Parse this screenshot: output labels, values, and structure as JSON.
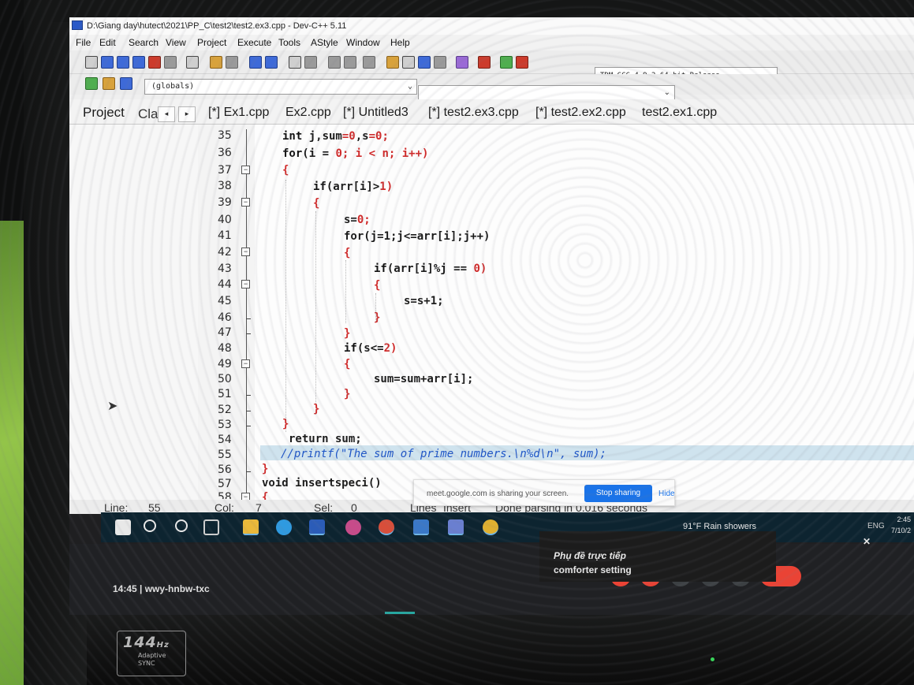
{
  "window": {
    "title": "D:\\Giang day\\hutect\\2021\\PP_C\\test2\\test2.ex3.cpp - Dev-C++ 5.11"
  },
  "menu": [
    "File",
    "Edit",
    "Search",
    "View",
    "Project",
    "Execute",
    "Tools",
    "AStyle",
    "Window",
    "Help"
  ],
  "toolbar": {
    "compiler": "TDM-GCC 4.9.2 64-bit Release",
    "scope": "(globals)"
  },
  "panel": {
    "project_tab": "Project",
    "classes_tab": "Cla",
    "prev": "◂",
    "next": "▸"
  },
  "tabs": [
    "[*] Ex1.cpp",
    "Ex2.cpp",
    "[*] Untitled3",
    "[*] test2.ex3.cpp",
    "[*] test2.ex2.cpp",
    "test2.ex1.cpp"
  ],
  "editor": {
    "line_numbers": [
      "35",
      "36",
      "37",
      "38",
      "39",
      "40",
      "41",
      "42",
      "43",
      "44",
      "45",
      "46",
      "47",
      "48",
      "49",
      "50",
      "51",
      "52",
      "53",
      "54",
      "55",
      "56",
      "57",
      "58"
    ],
    "lines": {
      "l35a": "int ",
      "l35b": "j,sum",
      "l35c": "=0",
      "l35d": ",s",
      "l35e": "=0",
      "l35f": ";",
      "l36a": "for",
      "l36b": "(i = ",
      "l36c": "0",
      "l36d": "; i < n; i++)",
      "l37": "{",
      "l38a": "if",
      "l38b": "(arr[i]>",
      "l38c": "1",
      "l38d": ")",
      "l39": "{",
      "l40a": "s=",
      "l40b": "0",
      "l40c": ";",
      "l41": "for(j=1;j<=arr[i];j++)",
      "l42": "{",
      "l43a": "if",
      "l43b": "(arr[i]%j == ",
      "l43c": "0",
      "l43d": ")",
      "l44": "{",
      "l45": "s=s+1;",
      "l46": "}",
      "l47": "}",
      "l48a": "if",
      "l48b": "(s<=",
      "l48c": "2",
      "l48d": ")",
      "l49": "{",
      "l50": "sum=sum+arr[i];",
      "l51": "}",
      "l52": "}",
      "l53": "}",
      "l54": "return sum;",
      "l55": "//printf(\"The sum of prime numbers.\\n%d\\n\", sum);",
      "l56": "}",
      "l57": "void insertspeci()",
      "l58": "{"
    }
  },
  "status": {
    "line_label": "Line:",
    "line_value": "55",
    "col_label": "Col:",
    "col_value": "7",
    "sel_label": "Sel:",
    "sel_value": "0",
    "lines_label": "Lines",
    "insert": "Insert",
    "parse": "Done parsing in 0.016 seconds"
  },
  "share_bar": {
    "message": "meet.google.com is sharing your screen.",
    "stop": "Stop sharing",
    "hide": "Hide"
  },
  "taskbar": {
    "weather": "91°F Rain showers",
    "lang": "ENG",
    "time": "2:45",
    "date": "7/10/2"
  },
  "captions": {
    "close": "✕",
    "line1": "Phụ đề trực tiếp",
    "line2": "comforter setting"
  },
  "meet": {
    "time_code": "14:45 | wwy-hnbw-txc"
  },
  "monitor": {
    "refresh": "144",
    "hz_unit": "Hz",
    "adaptive": "Adaptive",
    "sync": "SYNC"
  }
}
